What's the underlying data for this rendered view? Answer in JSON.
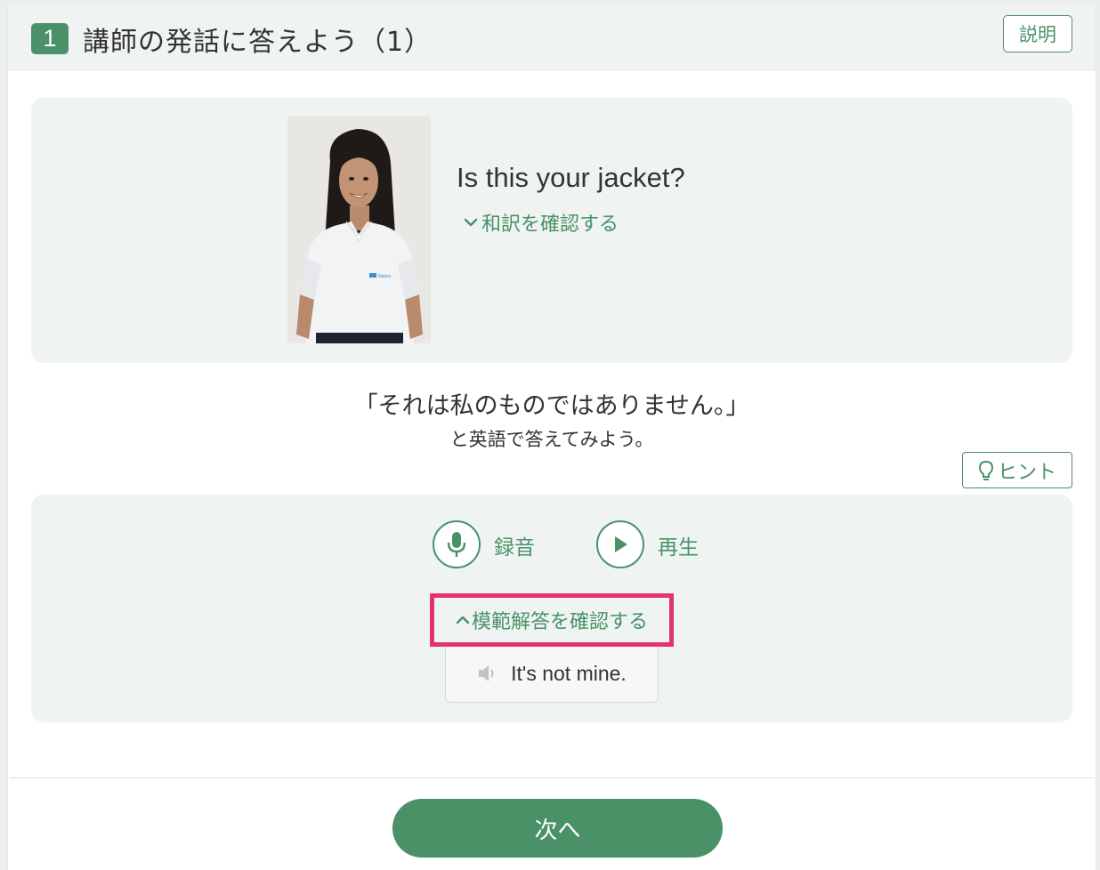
{
  "header": {
    "step_number": "1",
    "title": "講師の発話に答えよう（1）",
    "explain_label": "説明"
  },
  "prompt": {
    "question": "Is this your jacket?",
    "translate_label": "和訳を確認する",
    "translate_icon": "chevron-down-icon",
    "photo_logo": "Native"
  },
  "instruction": {
    "main": "「それは私のものではありません。」",
    "sub": "と英語で答えてみよう。"
  },
  "hint": {
    "label": "ヒント",
    "icon": "lightbulb-icon"
  },
  "controls": {
    "record_label": "録音",
    "record_icon": "microphone-icon",
    "play_label": "再生",
    "play_icon": "play-icon"
  },
  "model_answer": {
    "toggle_label": "模範解答を確認する",
    "toggle_icon": "chevron-up-icon",
    "text": "It's not mine.",
    "audio_icon": "speaker-icon"
  },
  "footer": {
    "next_label": "次へ"
  },
  "colors": {
    "accent": "#4a9168",
    "highlight": "#e2336e",
    "panel_bg": "#eff4f2"
  }
}
